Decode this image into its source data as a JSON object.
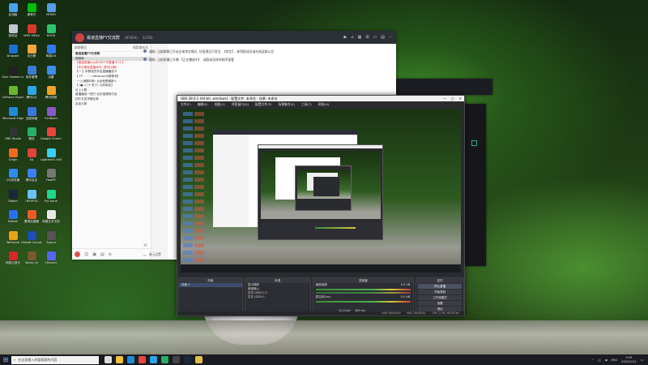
{
  "desktop_icons": [
    {
      "label": "此电脑",
      "color": "#4aa3e8"
    },
    {
      "label": "回收站",
      "color": "#bfc7d2"
    },
    {
      "label": "Dropshe",
      "color": "#1d6fd1"
    },
    {
      "label": "Epic Games Launcher",
      "color": "#222"
    },
    {
      "label": "GeForce Experience",
      "color": "#6cb52d"
    },
    {
      "label": "Microsoft Edge",
      "color": "#1d8ed6"
    },
    {
      "label": "OBS Studio",
      "color": "#333"
    },
    {
      "label": "Origin",
      "color": "#f06a1e"
    },
    {
      "label": "QQ浏览器",
      "color": "#2e8cf0"
    },
    {
      "label": "Steam",
      "color": "#1b2838"
    },
    {
      "label": "ToDesk",
      "color": "#2a6ff0"
    },
    {
      "label": "WeGame",
      "color": "#e8a317"
    },
    {
      "label": "网易云音乐",
      "color": "#d32a2a"
    },
    {
      "label": "爱奇艺",
      "color": "#00be06"
    },
    {
      "label": "WPS Office",
      "color": "#d63a2e"
    },
    {
      "label": "向日葵",
      "color": "#f2a63b"
    },
    {
      "label": "软件管理",
      "color": "#3b7bd6"
    },
    {
      "label": "腾讯QQ",
      "color": "#2aa6e8"
    },
    {
      "label": "百度网盘",
      "color": "#3a78e0"
    },
    {
      "label": "微信",
      "color": "#2aae67"
    },
    {
      "label": "EA",
      "color": "#e0443a"
    },
    {
      "label": "腾讯会议",
      "color": "#3c7df0"
    },
    {
      "label": "UPUPOO",
      "color": "#6cc0f5"
    },
    {
      "label": "雷神加速器",
      "color": "#ea5a2c"
    },
    {
      "label": "Ubisoft Connect",
      "color": "#1c4fb8"
    },
    {
      "label": "World_of",
      "color": "#7a5a2f"
    },
    {
      "label": "MOMO",
      "color": "#5a9be6"
    },
    {
      "label": "KOOK",
      "color": "#2bc46d"
    },
    {
      "label": "网易UU",
      "color": "#2f7bea"
    },
    {
      "label": "迅雷",
      "color": "#3e8df0"
    },
    {
      "label": "腾讯视频",
      "color": "#f0a32a"
    },
    {
      "label": "FunBuild",
      "color": "#8a5ac8"
    },
    {
      "label": "Google Chrome",
      "color": "#e8453c"
    },
    {
      "label": "LogitechG HUB",
      "color": "#3ad0f0"
    },
    {
      "label": "FastPS",
      "color": "#777"
    },
    {
      "label": "PyCharm",
      "color": "#21d789"
    },
    {
      "label": "新建文本文档",
      "color": "#e8e8e8"
    },
    {
      "label": "Typora",
      "color": "#555"
    },
    {
      "label": "Discord",
      "color": "#5865f2"
    }
  ],
  "chat": {
    "group_name": "最速直播FY交流群",
    "group_sub": "(87404)",
    "count": "32760",
    "left_header": "群聊模式",
    "left_search": "搜索群成员",
    "list_items": [
      {
        "text": "最速直播FY交流群",
        "style": "bold"
      },
      {
        "text": "鹅鹅鹅",
        "style": "sel"
      },
      {
        "text": "【最速直播bug@3807号直播卡13·】",
        "style": "red"
      },
      {
        "text": "【本次更新直播间号: 请勿吐槽】",
        "style": "red"
      },
      {
        "text": "【一·】本群成员开启直播播放卡",
        "style": "normal"
      },
      {
        "text": "【 FY· · · · · ridfosnorfin群群号】",
        "style": "normal"
      },
      {
        "text": "· 一入海图尔斯: 从此就是最新+",
        "style": "normal"
      },
      {
        "text": "【 (●--) (✦ 来了) 小的网名】",
        "style": "normal"
      },
      {
        "text": "月上人群",
        "style": "normal"
      },
      {
        "text": "直播播放一把刀 北京宝德帕尔克",
        "style": "normal"
      },
      {
        "text": "四叶文友学籍名单",
        "style": "normal"
      },
      {
        "text": "百变众群",
        "style": "normal"
      }
    ],
    "messages": [
      "通知: 当前群聊已开启全体禁言模式, 仅管理员可发言. 【禁言】, 新到群成员请先阅读群公告",
      "通知: 当前直播已开播 【正在播放中】, 请群成员保持秩序观看"
    ],
    "bottom_label": "演示设置"
  },
  "obs": {
    "title": "OBS 28.0.1 (64-bit, windows) - 配置文件: 未命名 - 场景: 未命名",
    "menu": [
      "文件(F)",
      "编辑(E)",
      "视图(V)",
      "停靠窗口(D)",
      "配置文件(P)",
      "场景集合(S)",
      "工具(T)",
      "帮助(H)"
    ],
    "docks": {
      "scenes": {
        "title": "场景",
        "items": [
          "场景 2"
        ]
      },
      "sources": {
        "title": "来源",
        "items": [
          "显示捕获",
          "音频输入",
          "文字 (GDI+) 2",
          "文字 (GDI+)"
        ]
      },
      "mixer": {
        "title": "混音器",
        "items": [
          "桌面音频",
          "麦克风/Aux"
        ],
        "db": [
          "0.0 dB",
          "0.0 dB"
        ]
      },
      "transitions": {
        "title": "转场特效",
        "type": "淡入淡出",
        "duration": "300 ms"
      },
      "controls": {
        "title": "控件",
        "buttons": [
          "停止直播",
          "开始录制",
          "工作室模式",
          "设置",
          "退出"
        ]
      }
    },
    "status": {
      "live": "LIVE: 00:00:00",
      "rec": "REC: 00:00:00",
      "cpu": "CPU: 2.5%, 60.00 fps"
    }
  },
  "taskbar": {
    "search_placeholder": "在这里输入你要搜索的内容",
    "apps": [
      {
        "name": "task-view",
        "color": "#ddd"
      },
      {
        "name": "explorer",
        "color": "#f2c23a"
      },
      {
        "name": "edge",
        "color": "#1d8ed6"
      },
      {
        "name": "chrome",
        "color": "#e8453c"
      },
      {
        "name": "qq",
        "color": "#2aa6e8"
      },
      {
        "name": "wechat",
        "color": "#2aae67"
      },
      {
        "name": "obs",
        "color": "#444"
      },
      {
        "name": "steam",
        "color": "#1b2838"
      },
      {
        "name": "other",
        "color": "#e0c04a"
      }
    ],
    "time": "9:29",
    "date": "2022/2/11",
    "lang": "ENG"
  }
}
